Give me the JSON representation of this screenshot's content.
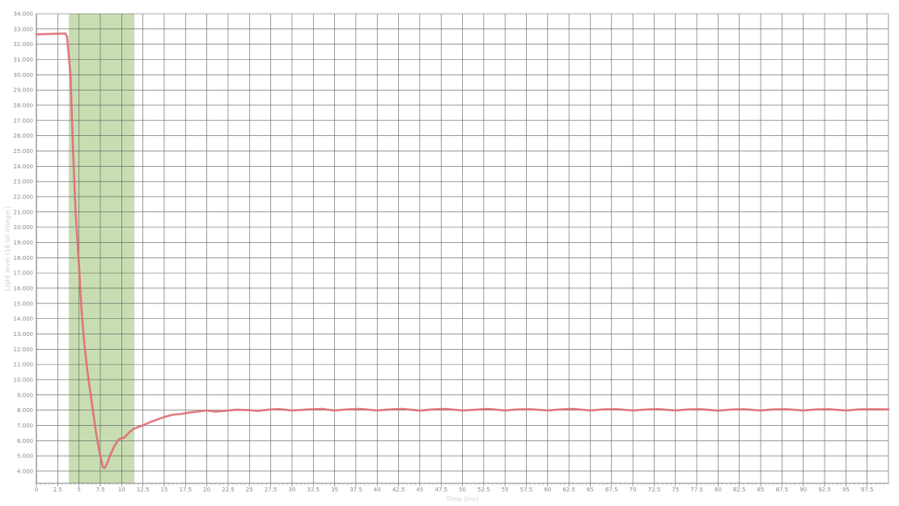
{
  "chart_data": {
    "type": "line",
    "title": "",
    "xlabel": "Time (ms)",
    "ylabel": "Light level (16 bit integer)",
    "xlim": [
      0,
      100
    ],
    "ylim": [
      3200,
      34000
    ],
    "x_ticks": [
      0,
      2.5,
      5,
      7.5,
      10,
      12.5,
      15,
      17.5,
      20,
      22.5,
      25,
      27.5,
      30,
      32.5,
      35,
      37.5,
      40,
      42.5,
      45,
      47.5,
      50,
      52.5,
      55,
      57.5,
      60,
      62.5,
      65,
      67.5,
      70,
      72.5,
      75,
      77.5,
      80,
      82.5,
      85,
      87.5,
      90,
      92.5,
      95,
      97.5
    ],
    "y_ticks": [
      4000,
      5000,
      6000,
      7000,
      8000,
      9000,
      10000,
      11000,
      12000,
      13000,
      14000,
      15000,
      16000,
      17000,
      18000,
      19000,
      20000,
      21000,
      22000,
      23000,
      24000,
      25000,
      26000,
      27000,
      28000,
      29000,
      30000,
      31000,
      32000,
      33000,
      34000
    ],
    "y_tick_labels": [
      "4.000",
      "5.000",
      "6.000",
      "7.000",
      "8.000",
      "9.000",
      "10.000",
      "11.000",
      "12.000",
      "13.000",
      "14.000",
      "15.000",
      "16.000",
      "17.000",
      "18.000",
      "19.000",
      "20.000",
      "21.000",
      "22.000",
      "23.000",
      "24.000",
      "25.000",
      "26.000",
      "27.000",
      "28.000",
      "29.000",
      "30.000",
      "31.000",
      "32.000",
      "33.000",
      "34.000"
    ],
    "grid": true,
    "highlight_region": {
      "x_start": 3.8,
      "x_end": 11.5,
      "color": "#c9ddb2"
    },
    "series": [
      {
        "color": "#e06b76",
        "points": [
          [
            0,
            32650
          ],
          [
            2,
            32680
          ],
          [
            3.4,
            32700
          ],
          [
            3.6,
            32500
          ],
          [
            4.0,
            30000
          ],
          [
            4.3,
            25000
          ],
          [
            4.6,
            21000
          ],
          [
            5.0,
            17500
          ],
          [
            5.3,
            14500
          ],
          [
            5.6,
            12500
          ],
          [
            6.0,
            10500
          ],
          [
            6.5,
            8500
          ],
          [
            7.0,
            6500
          ],
          [
            7.5,
            5000
          ],
          [
            7.8,
            4250
          ],
          [
            8.0,
            4200
          ],
          [
            8.3,
            4500
          ],
          [
            8.7,
            5100
          ],
          [
            9.2,
            5700
          ],
          [
            9.7,
            6100
          ],
          [
            10.3,
            6200
          ],
          [
            11.0,
            6600
          ],
          [
            11.5,
            6800
          ],
          [
            12.5,
            7000
          ],
          [
            13.5,
            7250
          ],
          [
            15.0,
            7550
          ],
          [
            16.0,
            7700
          ],
          [
            17.0,
            7750
          ],
          [
            18.0,
            7850
          ],
          [
            20.0,
            7980
          ],
          [
            21.0,
            7900
          ],
          [
            22.0,
            7950
          ],
          [
            23.5,
            8030
          ],
          [
            25.0,
            8000
          ],
          [
            26.0,
            7950
          ],
          [
            27.5,
            8050
          ],
          [
            28.5,
            8070
          ],
          [
            30.0,
            7980
          ],
          [
            32.0,
            8050
          ],
          [
            33.5,
            8080
          ],
          [
            35.0,
            7980
          ],
          [
            36.5,
            8050
          ],
          [
            38.0,
            8080
          ],
          [
            40.0,
            7980
          ],
          [
            41.5,
            8050
          ],
          [
            43.0,
            8080
          ],
          [
            45.0,
            7970
          ],
          [
            46.5,
            8050
          ],
          [
            48.0,
            8080
          ],
          [
            50.0,
            7980
          ],
          [
            51.5,
            8030
          ],
          [
            53.0,
            8080
          ],
          [
            55.0,
            7980
          ],
          [
            56.5,
            8050
          ],
          [
            58.0,
            8060
          ],
          [
            60.0,
            7980
          ],
          [
            61.5,
            8050
          ],
          [
            63.0,
            8080
          ],
          [
            65.0,
            7980
          ],
          [
            66.5,
            8050
          ],
          [
            68.0,
            8070
          ],
          [
            70.0,
            7980
          ],
          [
            71.5,
            8040
          ],
          [
            73.0,
            8070
          ],
          [
            75.0,
            7980
          ],
          [
            76.5,
            8050
          ],
          [
            78.0,
            8060
          ],
          [
            80.0,
            7970
          ],
          [
            81.5,
            8040
          ],
          [
            83.0,
            8060
          ],
          [
            85.0,
            7980
          ],
          [
            86.5,
            8050
          ],
          [
            88.0,
            8060
          ],
          [
            90.0,
            7980
          ],
          [
            91.5,
            8050
          ],
          [
            93.0,
            8060
          ],
          [
            95.0,
            7980
          ],
          [
            96.5,
            8050
          ],
          [
            98.0,
            8060
          ],
          [
            100.0,
            8050
          ]
        ]
      }
    ]
  }
}
